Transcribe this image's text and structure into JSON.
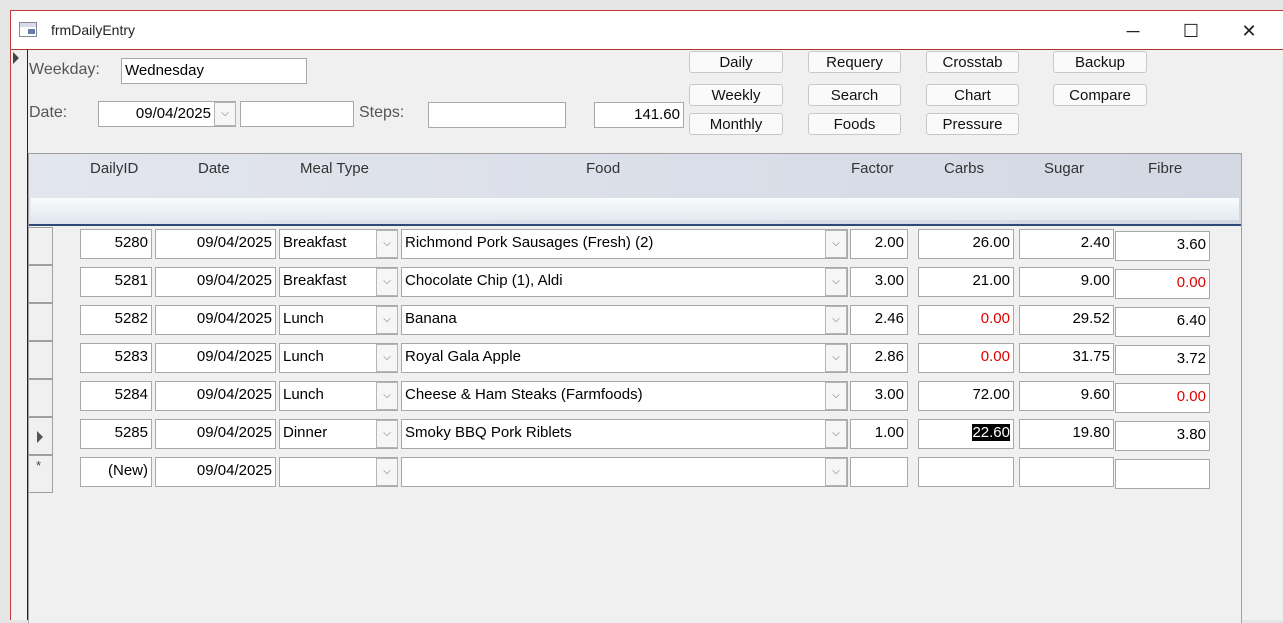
{
  "window": {
    "title": "frmDailyEntry",
    "minimize": "─",
    "maximize": "☐",
    "close": "✕"
  },
  "header": {
    "weekday_label": "Weekday:",
    "weekday_value": "Wednesday",
    "date_label": "Date:",
    "date_value": "09/04/2025",
    "extra_value": "",
    "steps_label": "Steps:",
    "steps_value": "",
    "total_value": "141.60"
  },
  "buttons": {
    "daily": "Daily",
    "weekly": "Weekly",
    "monthly": "Monthly",
    "requery": "Requery",
    "search": "Search",
    "foods": "Foods",
    "crosstab": "Crosstab",
    "chart": "Chart",
    "pressure": "Pressure",
    "backup": "Backup",
    "compare": "Compare"
  },
  "columns": {
    "id": "DailyID",
    "date": "Date",
    "meal": "Meal Type",
    "food": "Food",
    "factor": "Factor",
    "carbs": "Carbs",
    "sugar": "Sugar",
    "fibre": "Fibre"
  },
  "rows": [
    {
      "id": "5280",
      "date": "09/04/2025",
      "meal": "Breakfast",
      "food": "Richmond Pork Sausages (Fresh) (2)",
      "factor": "2.00",
      "carbs": "26.00",
      "sugar": "2.40",
      "fibre": "3.60"
    },
    {
      "id": "5281",
      "date": "09/04/2025",
      "meal": "Breakfast",
      "food": "Chocolate Chip (1), Aldi",
      "factor": "3.00",
      "carbs": "21.00",
      "sugar": "9.00",
      "fibre": "0.00"
    },
    {
      "id": "5282",
      "date": "09/04/2025",
      "meal": "Lunch",
      "food": "Banana",
      "factor": "2.46",
      "carbs": "0.00",
      "sugar": "29.52",
      "fibre": "6.40"
    },
    {
      "id": "5283",
      "date": "09/04/2025",
      "meal": "Lunch",
      "food": "Royal Gala Apple",
      "factor": "2.86",
      "carbs": "0.00",
      "sugar": "31.75",
      "fibre": "3.72"
    },
    {
      "id": "5284",
      "date": "09/04/2025",
      "meal": "Lunch",
      "food": "Cheese & Ham Steaks (Farmfoods)",
      "factor": "3.00",
      "carbs": "72.00",
      "sugar": "9.60",
      "fibre": "0.00"
    },
    {
      "id": "5285",
      "date": "09/04/2025",
      "meal": "Dinner",
      "food": "Smoky BBQ Pork Riblets",
      "factor": "1.00",
      "carbs": "22.60",
      "sugar": "19.80",
      "fibre": "3.80"
    }
  ],
  "new_row": {
    "id": "(New)",
    "date": "09/04/2025",
    "marker": "*"
  },
  "colors": {
    "zero": "#e00000",
    "accent": "#2b4a78"
  }
}
